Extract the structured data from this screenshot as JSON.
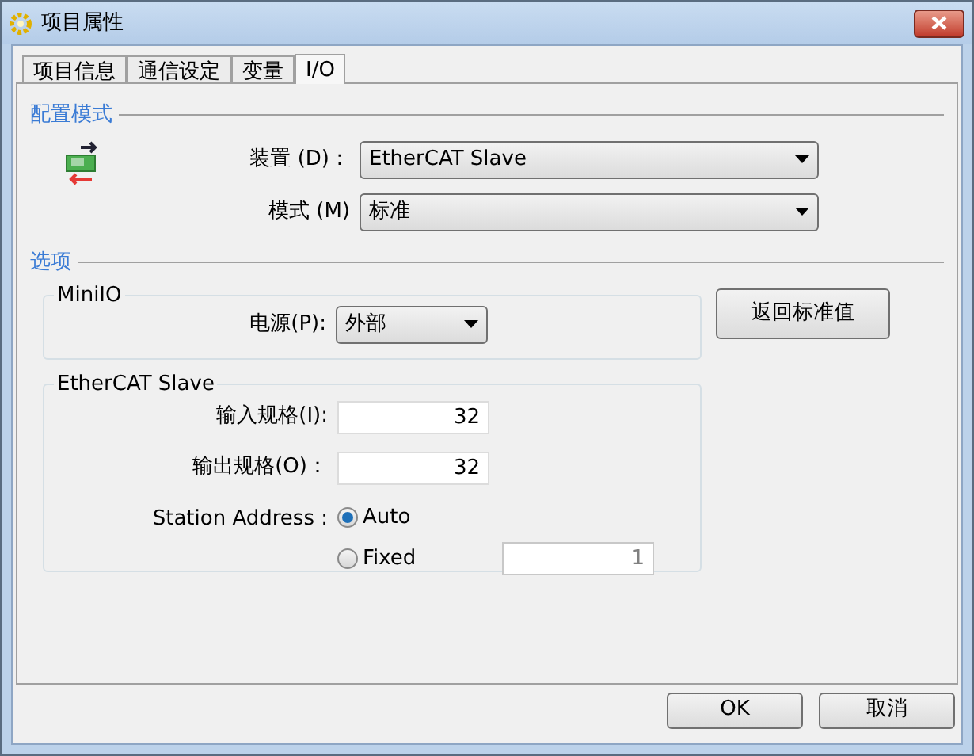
{
  "window": {
    "title": "项目属性"
  },
  "tabs": [
    {
      "label": "项目信息",
      "selected": false
    },
    {
      "label": "通信设定",
      "selected": false
    },
    {
      "label": "变量",
      "selected": false
    },
    {
      "label": "I/O",
      "selected": true
    }
  ],
  "config_section": {
    "title": "配置模式",
    "device": {
      "label": "装置 (D)：",
      "value": "EtherCAT Slave"
    },
    "mode": {
      "label": "模式 (M)",
      "value": "标准"
    }
  },
  "options_section": {
    "title": "选项",
    "miniio": {
      "title": "MiniIO",
      "power": {
        "label": "电源(P):",
        "value": "外部"
      }
    },
    "reset_button": "返回标准值",
    "ethercat": {
      "title": "EtherCAT Slave",
      "input_size": {
        "label": "输入规格(I):",
        "value": "32"
      },
      "output_size": {
        "label": "输出规格(O)：",
        "value": "32"
      },
      "station_address": {
        "label": "Station Address :",
        "options": [
          {
            "label": "Auto",
            "selected": true
          },
          {
            "label": "Fixed",
            "selected": false
          }
        ],
        "fixed_value": {
          "value": "1",
          "disabled": true
        }
      }
    }
  },
  "buttons": [
    "OK",
    "取消"
  ]
}
